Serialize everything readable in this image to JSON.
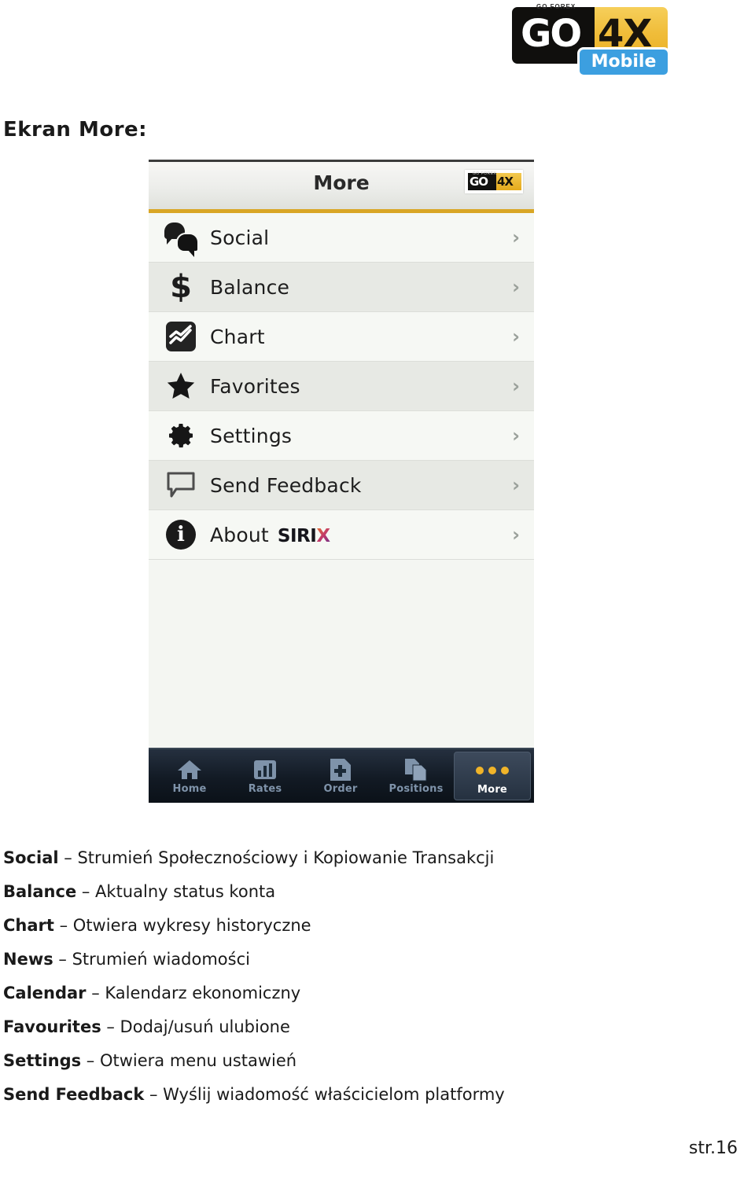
{
  "brand": {
    "tagline": "GO FOREX",
    "name_dark": "GO",
    "name_gold": "4X",
    "badge": "Mobile",
    "colors": {
      "gold": "#e9ae22",
      "blue": "#3c9fe0",
      "black": "#100f0d"
    }
  },
  "section": {
    "heading": "Ekran More:"
  },
  "screenshot": {
    "header": {
      "title": "More",
      "logo_dark": "GO",
      "logo_gold": "4X",
      "logo_tagline": "GO FOREX",
      "accent_color": "#d9a625"
    },
    "menu": [
      {
        "label": "Social",
        "icon": "speech-bubbles-icon",
        "chevron": "›"
      },
      {
        "label": "Balance",
        "icon": "dollar-sign-icon",
        "chevron": "›"
      },
      {
        "label": "Chart",
        "icon": "line-chart-icon",
        "chevron": "›"
      },
      {
        "label": "Favorites",
        "icon": "star-icon",
        "chevron": "›"
      },
      {
        "label": "Settings",
        "icon": "gear-icon",
        "chevron": "›"
      },
      {
        "label": "Send Feedback",
        "icon": "speech-bubble-outline-icon",
        "chevron": "›"
      },
      {
        "label": "About",
        "icon": "info-circle-icon",
        "chevron": "›",
        "brand_suffix_dark": "SIRI",
        "brand_suffix_accent": "X"
      }
    ],
    "tabs": [
      {
        "label": "Home",
        "icon": "house-icon",
        "active": false
      },
      {
        "label": "Rates",
        "icon": "bar-chart-icon",
        "active": false
      },
      {
        "label": "Order",
        "icon": "document-plus-icon",
        "active": false
      },
      {
        "label": "Positions",
        "icon": "documents-icon",
        "active": false
      },
      {
        "label": "More",
        "icon": "three-dots-icon",
        "active": true
      }
    ]
  },
  "descriptions": [
    {
      "term": "Social",
      "dash": " – ",
      "text": "Strumień Społecznościowy i Kopiowanie Transakcji"
    },
    {
      "term": "Balance",
      "dash": " – ",
      "text": "Aktualny status konta"
    },
    {
      "term": "Chart",
      "dash": " – ",
      "text": "Otwiera wykresy historyczne"
    },
    {
      "term": "News",
      "dash": " – ",
      "text": "Strumień wiadomości"
    },
    {
      "term": "Calendar",
      "dash": " – ",
      "text": "Kalendarz ekonomiczny"
    },
    {
      "term": "Favourites",
      "dash": " – ",
      "text": "Dodaj/usuń ulubione"
    },
    {
      "term": "Settings",
      "dash": " – ",
      "text": "Otwiera menu ustawień"
    },
    {
      "term": "Send Feedback",
      "dash": " – ",
      "text": "Wyślij wiadomość właścicielom platformy"
    }
  ],
  "footer": {
    "page": "str.16"
  }
}
